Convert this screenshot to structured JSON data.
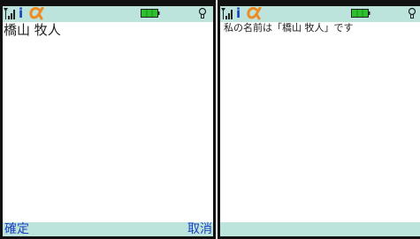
{
  "left_screen": {
    "input_text": "橋山 牧人",
    "softkeys": {
      "left": "確定",
      "right": "取消"
    }
  },
  "right_screen": {
    "message": "私の名前は「橋山 牧人」です"
  },
  "status_bar": {
    "imode_label": "i",
    "icons": [
      "signal-icon",
      "imode-icon",
      "appli-icon",
      "battery-icon",
      "bulb-icon"
    ]
  },
  "colors": {
    "bar_background": "#bde4dc",
    "softkey_text": "#1a3fc0",
    "appli_icon": "#f08a24",
    "battery_fill": "#2dbf2d"
  }
}
